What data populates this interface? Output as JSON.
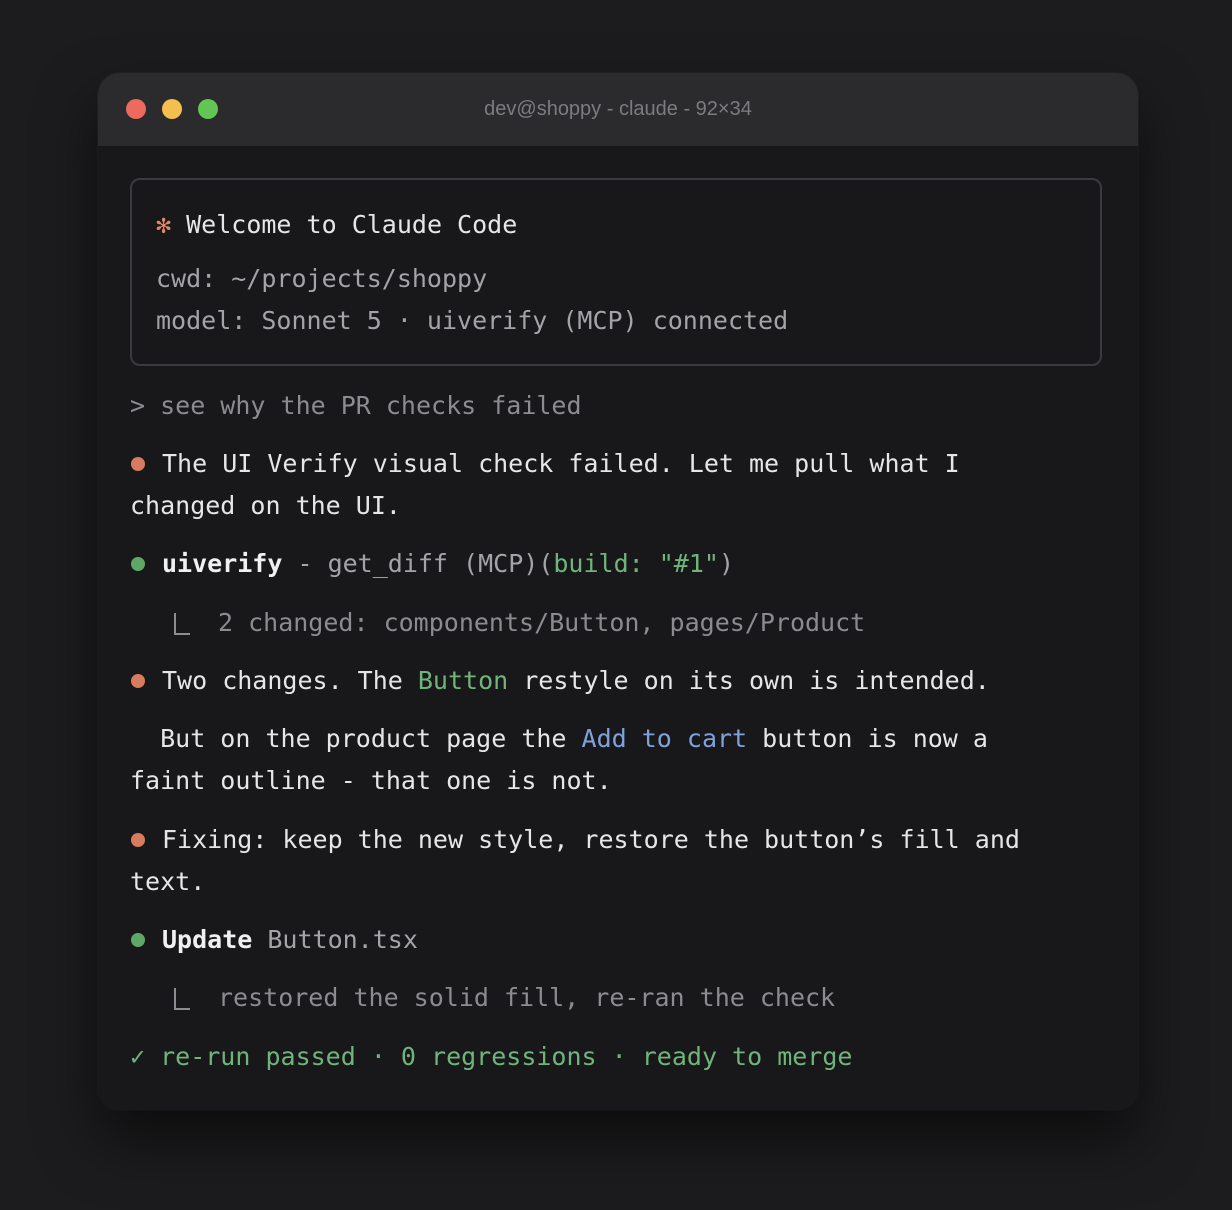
{
  "window": {
    "title": "dev@shoppy - claude - 92×34"
  },
  "welcome": {
    "star": "✻",
    "heading": "Welcome to Claude Code",
    "cwd": "cwd: ~/projects/shoppy",
    "model": "model: Sonnet 5 · uiverify (MCP) connected"
  },
  "prompt": "> see why the PR checks failed",
  "messages": {
    "m1_line1": "The UI Verify visual check failed. Let me pull what I",
    "m1_line2": "changed on the UI.",
    "tool_name": "uiverify",
    "tool_call": " - get_diff (MCP)(",
    "tool_args": "build: \"#1\"",
    "tool_close": ")",
    "tool_result": "2 changed: components/Button, pages/Product",
    "m2_a": "Two changes. The ",
    "m2_b": "Button",
    "m2_c": " restyle on its own is intended.",
    "m3_a": "  But on the product page the ",
    "m3_b": "Add to cart",
    "m3_c": " button is now a",
    "m3_line2": "faint outline - that one is not.",
    "m4_line1": "Fixing: keep the new style, restore the button’s fill and",
    "m4_line2": "text.",
    "update_label": "Update",
    "update_file": " Button.tsx",
    "update_result": "restored the solid fill, re-ran the check",
    "final_status": "✓ re-run passed · 0 regressions · ready to merge"
  },
  "colors": {
    "bullet_orange": "#d87c60",
    "bullet_green": "#5fa766",
    "accent_green": "#6fb57a",
    "accent_blue": "#7ea2d9"
  }
}
